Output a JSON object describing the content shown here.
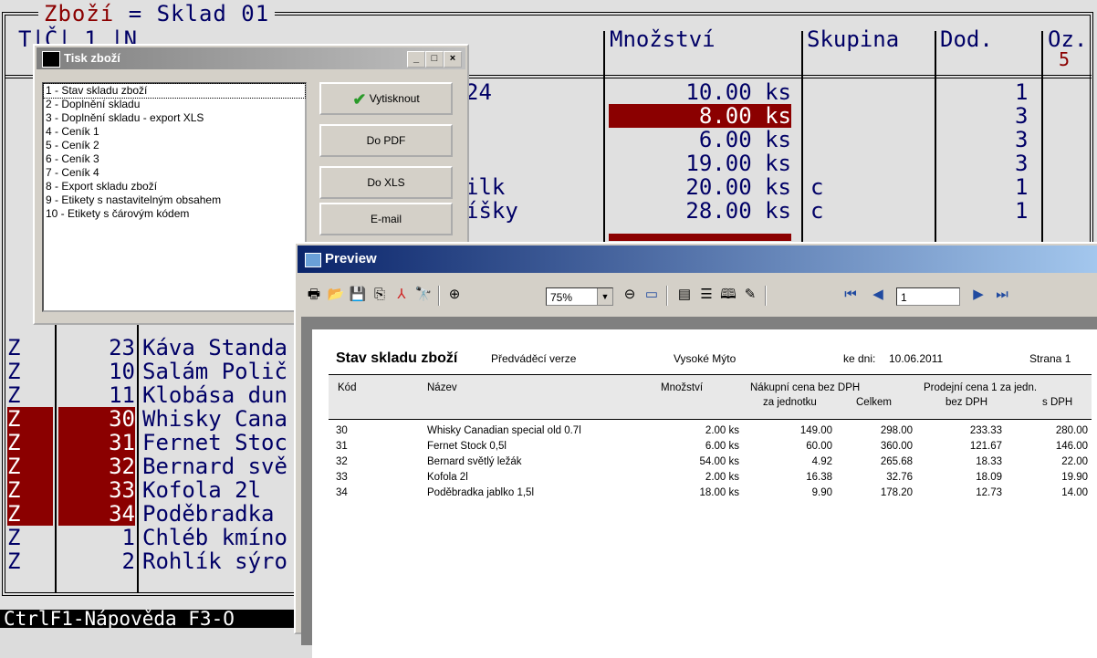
{
  "terminal": {
    "title_left": "Zboží",
    "title_eq": "=",
    "title_right": "Sklad 01",
    "headers": {
      "partial": "T|Č| 1 |N",
      "mnozstvi": "Množství",
      "skupina": "Skupina",
      "dod": "Dod.",
      "oz": "Oz."
    },
    "oz_num": "5",
    "upper_rows": [
      {
        "name_tail": "24",
        "qty": "10.00 ks",
        "skupina": "",
        "dod": "1",
        "hl": false
      },
      {
        "name_tail": "",
        "qty": "8.00 ks",
        "skupina": "",
        "dod": "3",
        "hl": true
      },
      {
        "name_tail": "",
        "qty": "6.00 ks",
        "skupina": "",
        "dod": "3",
        "hl": false
      },
      {
        "name_tail": "",
        "qty": "19.00 ks",
        "skupina": "",
        "dod": "3",
        "hl": false
      },
      {
        "name_tail": "ilk",
        "qty": "20.00 ks",
        "skupina": "c",
        "dod": "1",
        "hl": false
      },
      {
        "name_tail": "íšky",
        "qty": "28.00 ks",
        "skupina": "c",
        "dod": "1",
        "hl": false
      }
    ],
    "lower_rows": [
      {
        "t": "Z",
        "num": "23",
        "name": "Káva Standa",
        "hl": false
      },
      {
        "t": "Z",
        "num": "10",
        "name": "Salám Polič",
        "hl": false
      },
      {
        "t": "Z",
        "num": "11",
        "name": "Klobása dun",
        "hl": false
      },
      {
        "t": "Z",
        "num": "30",
        "name": "Whisky Cana",
        "hl": true
      },
      {
        "t": "Z",
        "num": "31",
        "name": "Fernet Stoc",
        "hl": true
      },
      {
        "t": "Z",
        "num": "32",
        "name": "Bernard svě",
        "hl": true
      },
      {
        "t": "Z",
        "num": "33",
        "name": "Kofola 2l",
        "hl": true
      },
      {
        "t": "Z",
        "num": "34",
        "name": "Poděbradka",
        "hl": true
      },
      {
        "t": "Z",
        "num": "1",
        "name": "Chléb kmíno",
        "hl": false
      },
      {
        "t": "Z",
        "num": "2",
        "name": "Rohlík sýro",
        "hl": false
      }
    ],
    "status_bar": "CtrlF1-Nápověda F3-O"
  },
  "tisk_dialog": {
    "title": "Tisk zboží",
    "items": [
      "1 - Stav skladu zboží",
      "2 - Doplnění skladu",
      "3 - Doplnění skladu - export XLS",
      "4 - Ceník 1",
      "5 - Ceník 2",
      "6 - Ceník 3",
      "7 - Ceník 4",
      "8 - Export skladu zboží",
      "9 - Etikety s nastavitelným obsahem",
      "10 - Etikety s čárovým kódem"
    ],
    "buttons": {
      "print": "Vytisknout",
      "pdf": "Do PDF",
      "xls": "Do XLS",
      "email": "E-mail"
    }
  },
  "preview": {
    "title": "Preview",
    "zoom": "75%",
    "page": "1",
    "report": {
      "title": "Stav skladu zboží",
      "version": "Předváděcí verze",
      "city": "Vysoké Mýto",
      "date_label": "ke dni:",
      "date": "10.06.2011",
      "page_label": "Strana 1",
      "headers": {
        "kod": "Kód",
        "nazev": "Název",
        "mnozstvi": "Množství",
        "nakup": "Nákupní cena bez DPH",
        "za_jednotku": "za jednotku",
        "celkem": "Celkem",
        "prodej": "Prodejní cena 1 za jedn.",
        "bez_dph": "bez DPH",
        "s_dph": "s DPH"
      },
      "rows": [
        {
          "kod": "30",
          "nazev": "Whisky Canadian special old 0.7l",
          "mnozstvi": "2.00 ks",
          "za_jednotku": "149.00",
          "celkem": "298.00",
          "bez_dph": "233.33",
          "s_dph": "280.00"
        },
        {
          "kod": "31",
          "nazev": "Fernet Stock 0,5l",
          "mnozstvi": "6.00 ks",
          "za_jednotku": "60.00",
          "celkem": "360.00",
          "bez_dph": "121.67",
          "s_dph": "146.00"
        },
        {
          "kod": "32",
          "nazev": "Bernard světlý ležák",
          "mnozstvi": "54.00 ks",
          "za_jednotku": "4.92",
          "celkem": "265.68",
          "bez_dph": "18.33",
          "s_dph": "22.00"
        },
        {
          "kod": "33",
          "nazev": "Kofola 2l",
          "mnozstvi": "2.00 ks",
          "za_jednotku": "16.38",
          "celkem": "32.76",
          "bez_dph": "18.09",
          "s_dph": "19.90"
        },
        {
          "kod": "34",
          "nazev": "Poděbradka jablko 1,5l",
          "mnozstvi": "18.00 ks",
          "za_jednotku": "9.90",
          "celkem": "178.20",
          "bez_dph": "12.73",
          "s_dph": "14.00"
        }
      ]
    }
  }
}
